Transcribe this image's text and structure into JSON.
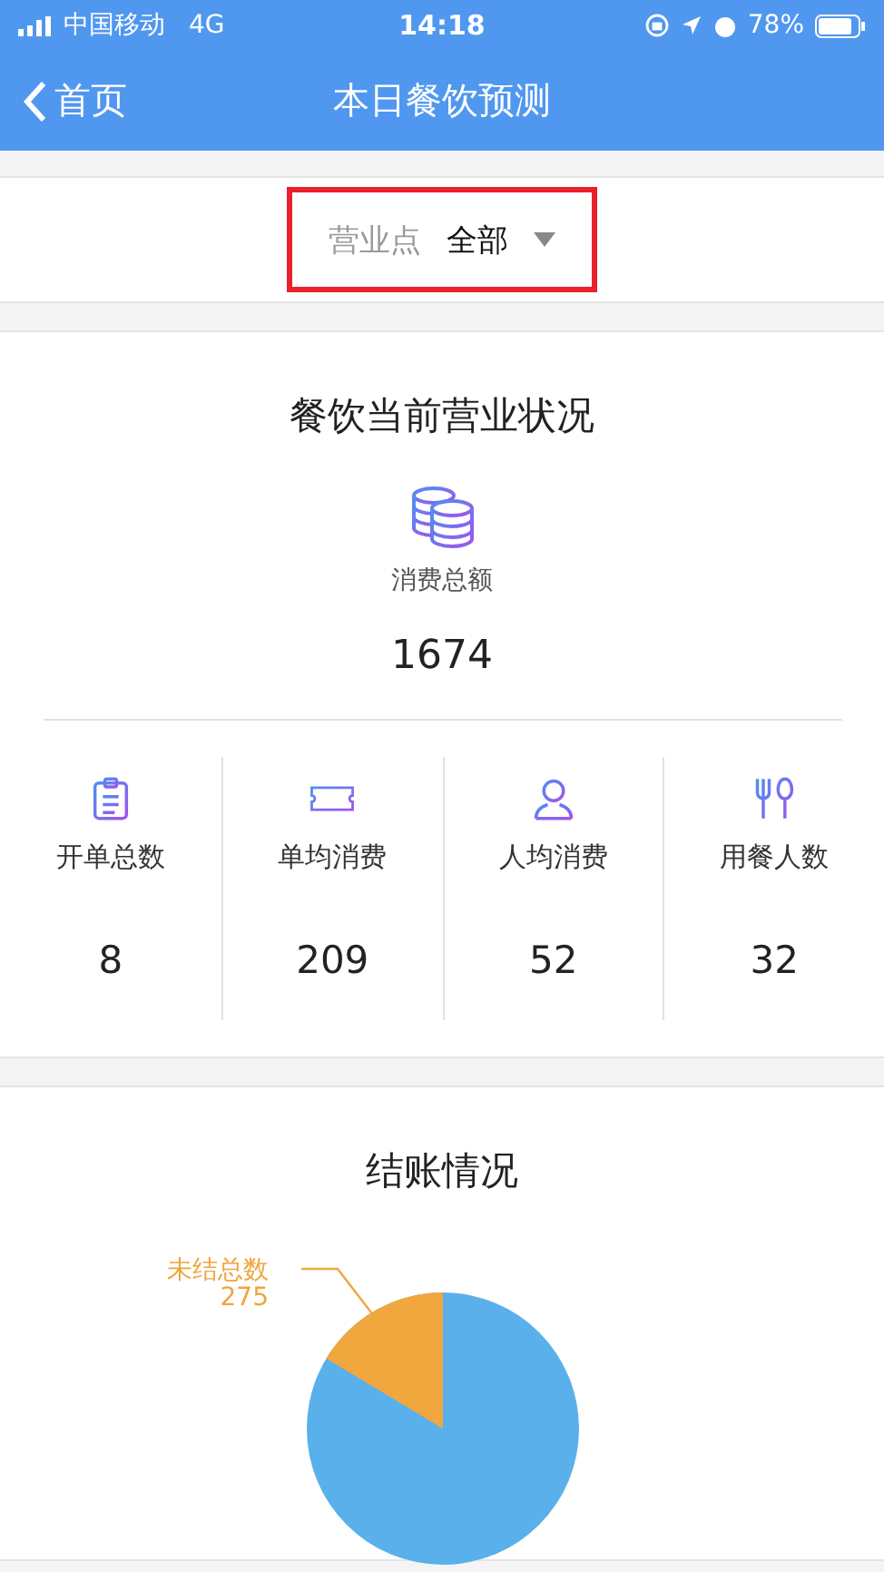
{
  "status_bar": {
    "carrier": "中国移动",
    "network": "4G",
    "time": "14:18",
    "battery": "78%"
  },
  "nav": {
    "back": "首页",
    "title": "本日餐饮预测"
  },
  "filter": {
    "label": "营业点",
    "value": "全部",
    "highlighted": true
  },
  "status_card": {
    "title": "餐饮当前营业状况",
    "total_label": "消费总额",
    "total_value": "1674",
    "stats": [
      {
        "kind": "clipboard",
        "label": "开单总数",
        "value": "8"
      },
      {
        "kind": "ticket",
        "label": "单均消费",
        "value": "209"
      },
      {
        "kind": "person",
        "label": "人均消费",
        "value": "52"
      },
      {
        "kind": "cutlery",
        "label": "用餐人数",
        "value": "32"
      }
    ]
  },
  "checkout_card": {
    "title": "结账情况",
    "slice_label": "未结总数",
    "slice_value": "275"
  }
}
